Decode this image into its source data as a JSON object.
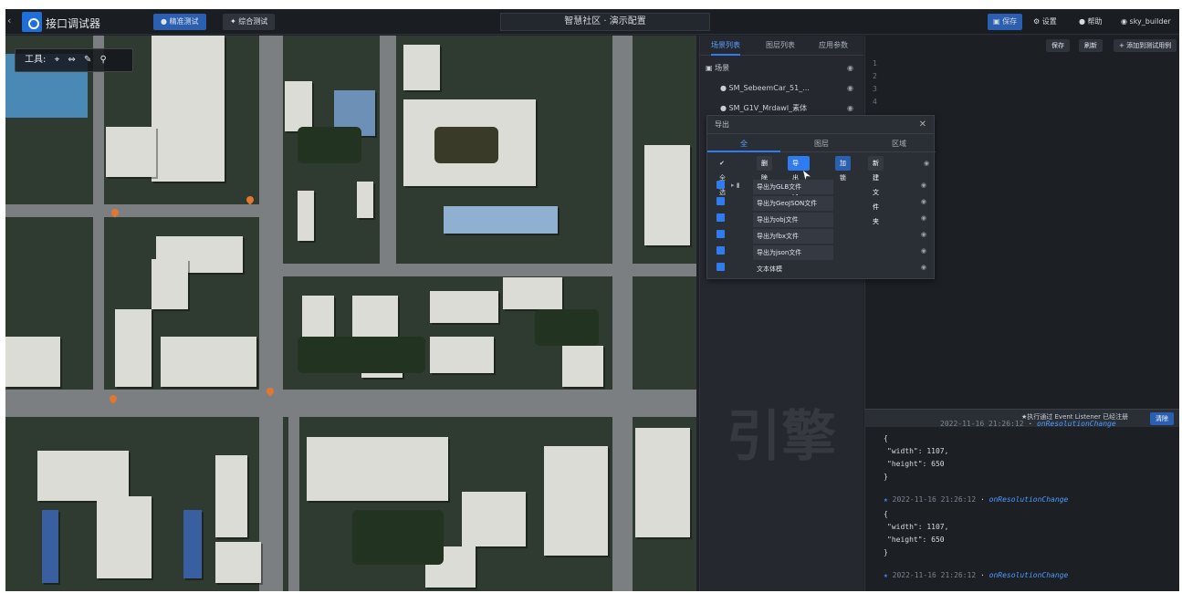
{
  "app": {
    "name": "接口调试器",
    "project_title": "智慧社区 · 演示配置"
  },
  "toolbar": {
    "primary": "精准测试",
    "secondary": "综合测试"
  },
  "header_right": {
    "save": "保存",
    "settings": "设置",
    "help": "帮助",
    "user": "sky_builder"
  },
  "map": {
    "tool_label": "工具:"
  },
  "scene_panel": {
    "tabs": [
      "场景列表",
      "图层列表",
      "应用参数"
    ],
    "root": "场景",
    "items": [
      "SM_SebeemCar_51_...",
      "SM_G1V_Mrdawl_素体"
    ]
  },
  "code_panel": {
    "btn_a": "保存",
    "btn_b": "刷新",
    "btn_add": "+ 添加到测试用例",
    "line_numbers": [
      "1",
      "2",
      "3",
      "4"
    ]
  },
  "popup": {
    "title": "导出",
    "tabs": [
      "全",
      "图层",
      "区域"
    ],
    "tools": {
      "check_all": "全选",
      "delete": "删除",
      "export": "导出为...",
      "lock": "加锁",
      "new_folder": "新建文件夹"
    },
    "rows": [
      "导出为GLB文件",
      "导出为GeoJSON文件",
      "导出为obj文件",
      "导出为fbx文件",
      "导出为json文件",
      "文本体模"
    ]
  },
  "console": {
    "message": "★执行通过 Event Listener 已经注册",
    "button": "清除",
    "entries": [
      {
        "time": "2022-11-16 21:26:12",
        "event": "onResolutionChange",
        "width_line": "\"width\": 1107,",
        "height_line": "\"height\": 650"
      },
      {
        "time": "2022-11-16 21:26:12",
        "event": "onResolutionChange",
        "width_line": "\"width\": 1107,",
        "height_line": "\"height\": 650"
      },
      {
        "time": "2022-11-16 21:26:12",
        "event": "onResolutionChange",
        "width_line": "",
        "height_line": ""
      }
    ]
  },
  "watermark": "引擎"
}
